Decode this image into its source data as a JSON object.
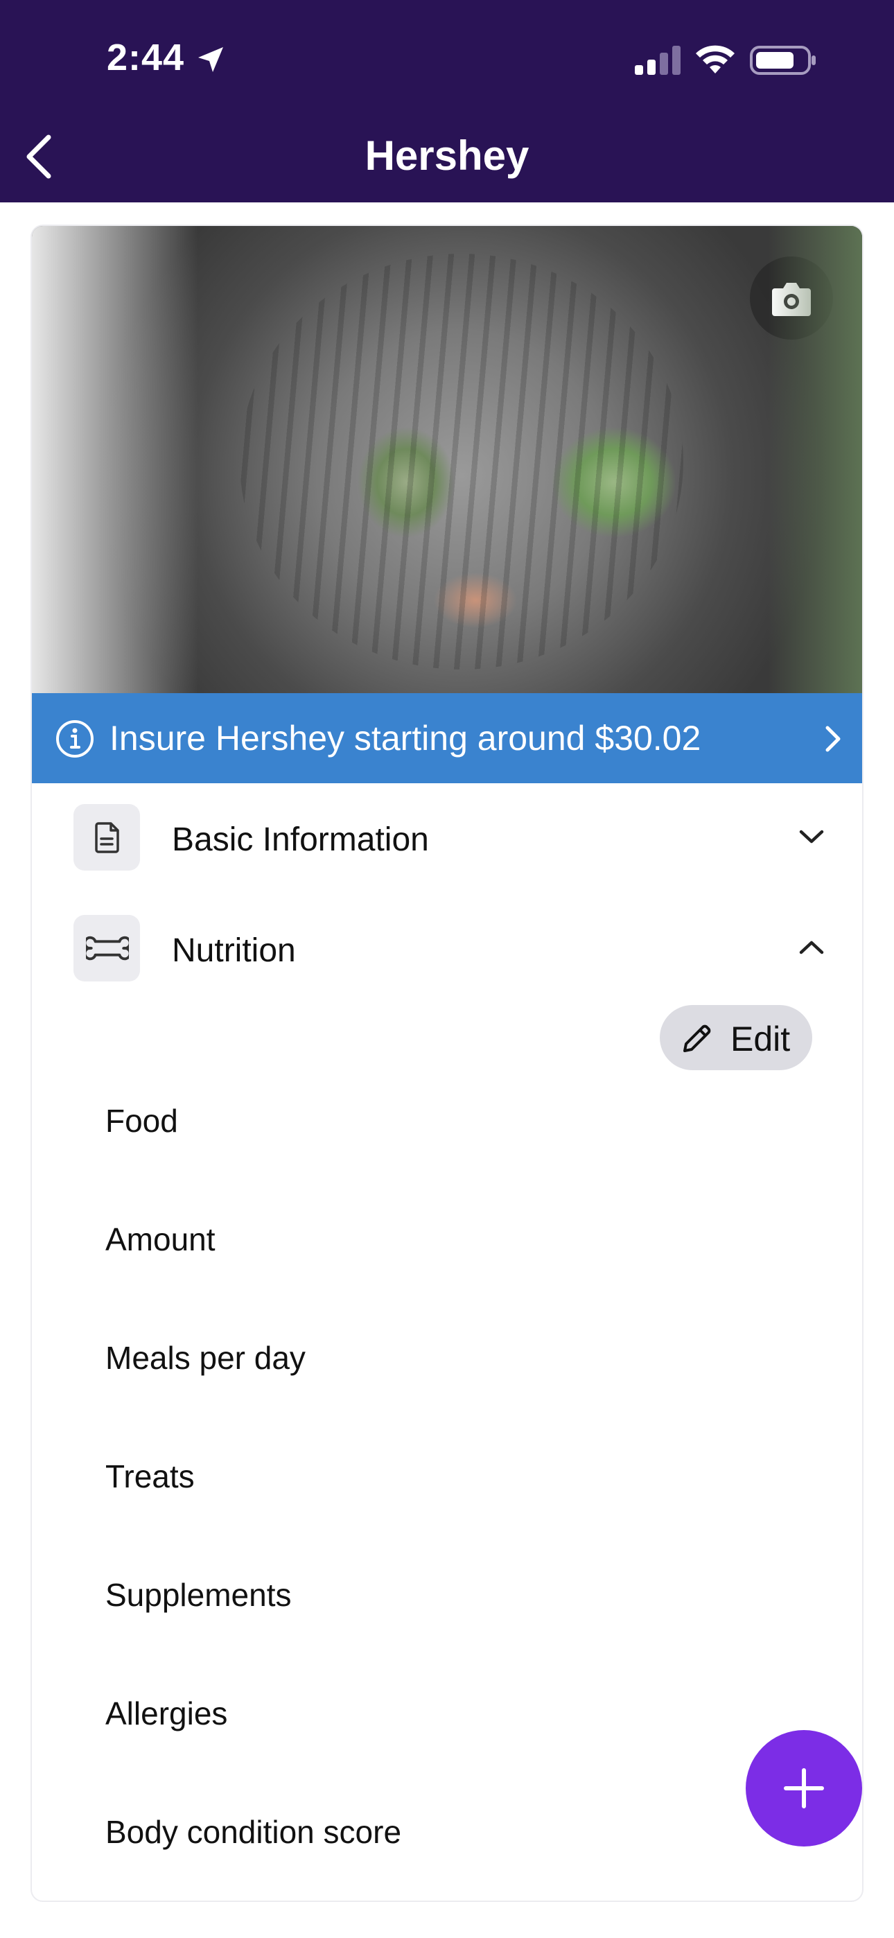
{
  "status_bar": {
    "time": "2:44",
    "location_icon": "location-arrow-icon",
    "signal_icon": "cellular-signal-icon",
    "wifi_icon": "wifi-icon",
    "battery_icon": "battery-icon"
  },
  "nav": {
    "title": "Hershey",
    "back_icon": "chevron-left-icon"
  },
  "pet_photo": {
    "camera_icon": "camera-icon"
  },
  "insure_banner": {
    "text": "Insure Hershey starting around $30.02",
    "info_icon": "info-circle-icon",
    "chevron_icon": "chevron-right-icon"
  },
  "sections": [
    {
      "label": "Basic Information",
      "icon": "document-icon",
      "state": "collapsed"
    },
    {
      "label": "Nutrition",
      "icon": "bone-icon",
      "state": "expanded"
    }
  ],
  "nutrition": {
    "edit_label": "Edit",
    "edit_icon": "pencil-icon",
    "fields": [
      "Food",
      "Amount",
      "Meals per day",
      "Treats",
      "Supplements",
      "Allergies",
      "Body condition score"
    ]
  },
  "fab": {
    "icon": "plus-icon"
  },
  "colors": {
    "header_bg": "#291355",
    "banner_bg": "#3a83cf",
    "fab_bg": "#7c2de6",
    "icon_tile_bg": "#ececf0",
    "edit_bg": "#dcdce2"
  }
}
